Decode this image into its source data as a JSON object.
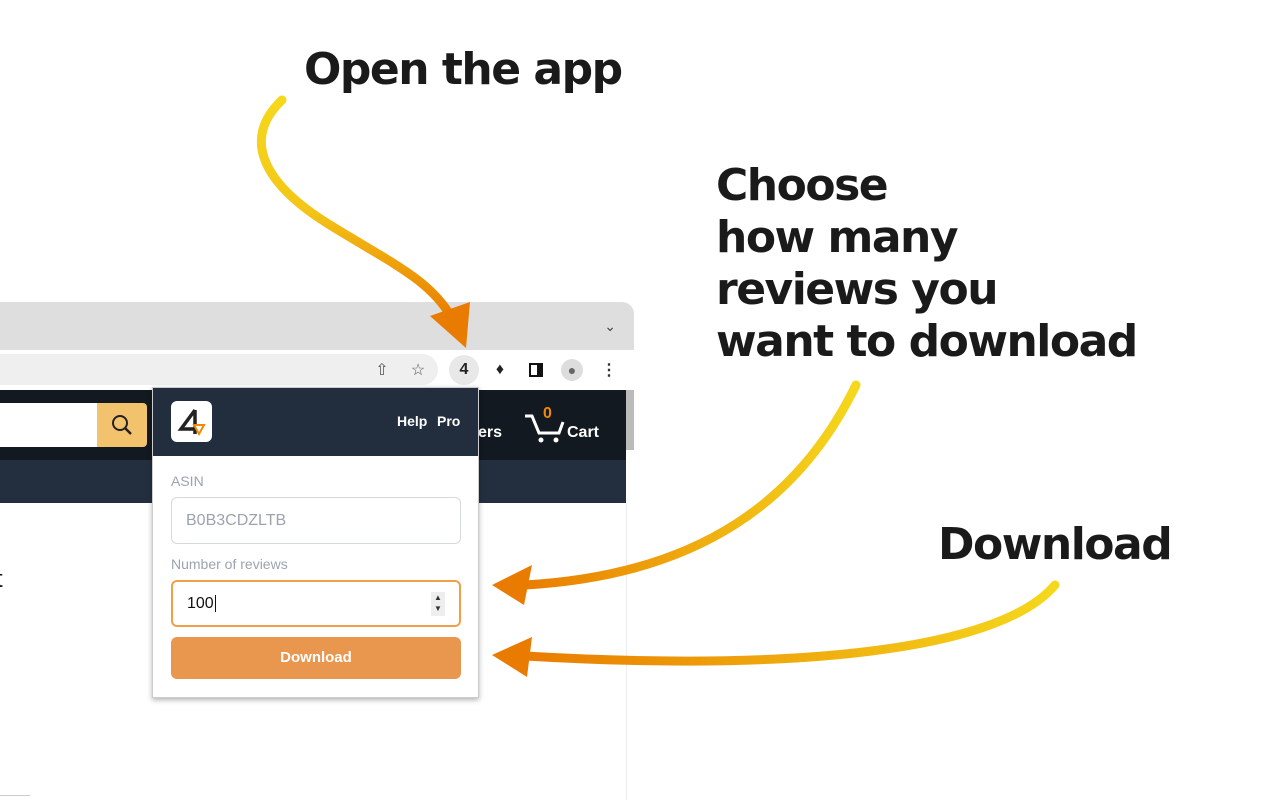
{
  "annotations": {
    "open_app": "Open the app",
    "choose_lines": [
      "Choose",
      "how many",
      "reviews you",
      "want to download"
    ],
    "download": "Download"
  },
  "colors": {
    "arrow_start": "#f5d81c",
    "arrow_end": "#e97c00",
    "popup_header": "#222d3d",
    "accent": "#e9964f"
  },
  "browser": {
    "toolbar_icons": [
      "share-icon",
      "star-icon",
      "extension-app-icon",
      "puzzle-icon",
      "sidebar-icon",
      "profile-icon",
      "menu-icon"
    ]
  },
  "site": {
    "nav_partial_text": "ers",
    "cart_count": "0",
    "cart_label": "Cart",
    "body_partial_text": "t"
  },
  "popup": {
    "help_link": "Help",
    "pro_link": "Pro",
    "asin_label": "ASIN",
    "asin_placeholder": "B0B3CDZLTB",
    "reviews_label": "Number of reviews",
    "reviews_value": "100",
    "download_button": "Download"
  }
}
